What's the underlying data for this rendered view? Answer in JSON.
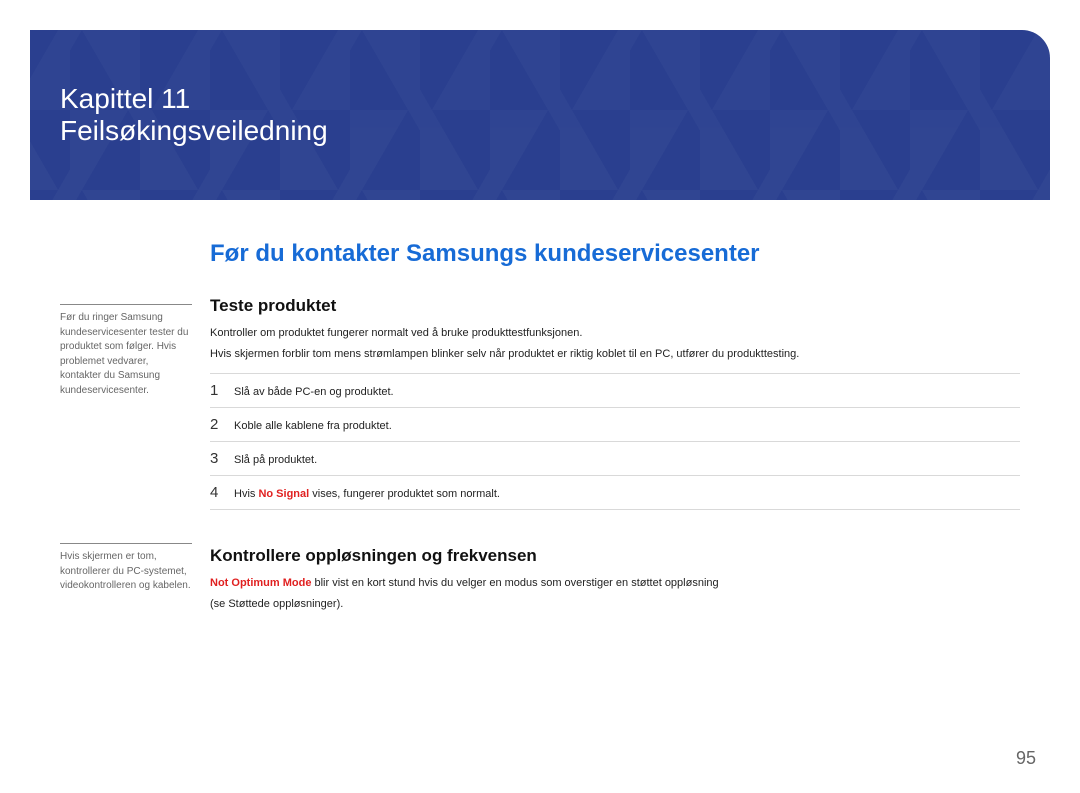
{
  "chapter": {
    "label": "Kapittel 11",
    "title": "Feilsøkingsveiledning"
  },
  "section_title": "Før du kontakter Samsungs kundeservicesenter",
  "notes": {
    "top": "Før du ringer Samsung kundeservicesenter tester du produktet som følger. Hvis problemet vedvarer, kontakter du Samsung kundeservicesenter.",
    "bottom": "Hvis skjermen er tom, kontrollerer du PC-systemet, videokontrolleren og kabelen."
  },
  "sub1": {
    "heading": "Teste produktet",
    "p1": "Kontroller om produktet fungerer normalt ved å bruke produkttestfunksjonen.",
    "p2": "Hvis skjermen forblir tom mens strømlampen blinker selv når produktet er riktig koblet til en PC, utfører du produkttesting.",
    "steps": [
      {
        "n": "1",
        "text": "Slå av både PC-en og produktet."
      },
      {
        "n": "2",
        "text": "Koble alle kablene fra produktet."
      },
      {
        "n": "3",
        "text": "Slå på produktet."
      },
      {
        "n": "4",
        "prefix": "Hvis ",
        "bold": "No Signal",
        "suffix": " vises, fungerer produktet som normalt."
      }
    ]
  },
  "sub2": {
    "heading": "Kontrollere oppløsningen og frekvensen",
    "bold": "Not Optimum Mode",
    "body": " blir vist en kort stund hvis du velger en modus som overstiger en støttet oppløsning",
    "body2": "(se Støttede oppløsninger)."
  },
  "page_number": "95"
}
